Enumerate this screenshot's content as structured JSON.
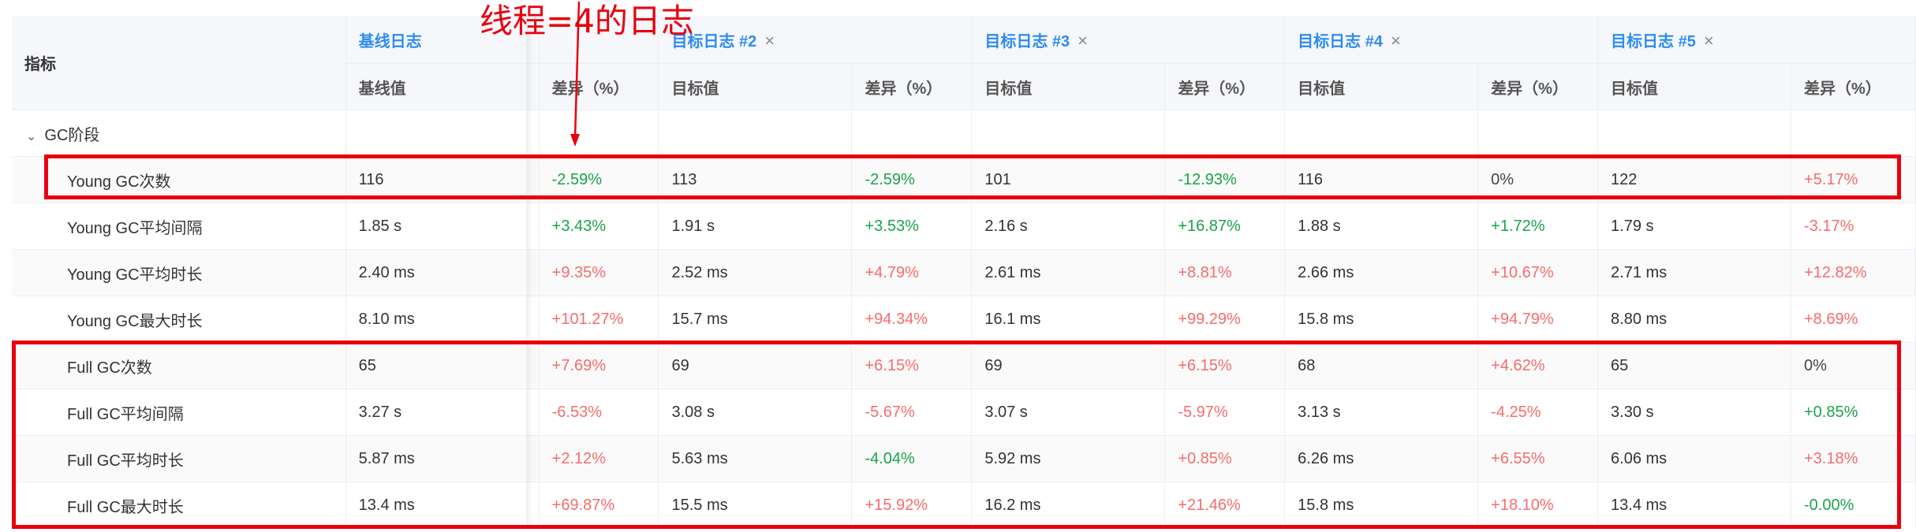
{
  "header": {
    "metric_label": "指标",
    "baseline_title": "基线日志",
    "baseline_value_label": "基线值",
    "diff_label": "差异（%）",
    "target_value_label": "目标值",
    "close_glyph": "×",
    "targets": [
      {
        "title": "目标日志 #2"
      },
      {
        "title": "目标日志 #3"
      },
      {
        "title": "目标日志 #4"
      },
      {
        "title": "目标日志 #5"
      }
    ]
  },
  "group": {
    "label": "GC阶段",
    "chevron": "⌄"
  },
  "rows": [
    {
      "name": "Young GC次数",
      "base": "116",
      "cells": [
        {
          "diff": "-2.59%",
          "t": "negative"
        },
        {
          "value": "113"
        },
        {
          "diff": "-2.59%",
          "t": "negative"
        },
        {
          "value": "101"
        },
        {
          "diff": "-12.93%",
          "t": "negative"
        },
        {
          "value": "116"
        },
        {
          "diff": "0%",
          "t": "zero"
        },
        {
          "value": "122"
        },
        {
          "diff": "+5.17%",
          "t": "positive"
        }
      ]
    },
    {
      "name": "Young GC平均间隔",
      "base": "1.85 s",
      "cells": [
        {
          "diff": "+3.43%",
          "t": "negative"
        },
        {
          "value": "1.91 s"
        },
        {
          "diff": "+3.53%",
          "t": "negative"
        },
        {
          "value": "2.16 s"
        },
        {
          "diff": "+16.87%",
          "t": "negative"
        },
        {
          "value": "1.88 s"
        },
        {
          "diff": "+1.72%",
          "t": "negative"
        },
        {
          "value": "1.79 s"
        },
        {
          "diff": "-3.17%",
          "t": "positive"
        }
      ]
    },
    {
      "name": "Young GC平均时长",
      "base": "2.40 ms",
      "cells": [
        {
          "diff": "+9.35%",
          "t": "positive"
        },
        {
          "value": "2.52 ms"
        },
        {
          "diff": "+4.79%",
          "t": "positive"
        },
        {
          "value": "2.61 ms"
        },
        {
          "diff": "+8.81%",
          "t": "positive"
        },
        {
          "value": "2.66 ms"
        },
        {
          "diff": "+10.67%",
          "t": "positive"
        },
        {
          "value": "2.71 ms"
        },
        {
          "diff": "+12.82%",
          "t": "positive"
        }
      ]
    },
    {
      "name": "Young GC最大时长",
      "base": "8.10 ms",
      "cells": [
        {
          "diff": "+101.27%",
          "t": "positive"
        },
        {
          "value": "15.7 ms"
        },
        {
          "diff": "+94.34%",
          "t": "positive"
        },
        {
          "value": "16.1 ms"
        },
        {
          "diff": "+99.29%",
          "t": "positive"
        },
        {
          "value": "15.8 ms"
        },
        {
          "diff": "+94.79%",
          "t": "positive"
        },
        {
          "value": "8.80 ms"
        },
        {
          "diff": "+8.69%",
          "t": "positive"
        }
      ]
    },
    {
      "name": "Full GC次数",
      "base": "65",
      "cells": [
        {
          "diff": "+7.69%",
          "t": "positive"
        },
        {
          "value": "69"
        },
        {
          "diff": "+6.15%",
          "t": "positive"
        },
        {
          "value": "69"
        },
        {
          "diff": "+6.15%",
          "t": "positive"
        },
        {
          "value": "68"
        },
        {
          "diff": "+4.62%",
          "t": "positive"
        },
        {
          "value": "65"
        },
        {
          "diff": "0%",
          "t": "zero"
        }
      ]
    },
    {
      "name": "Full GC平均间隔",
      "base": "3.27 s",
      "cells": [
        {
          "diff": "-6.53%",
          "t": "positive"
        },
        {
          "value": "3.08 s"
        },
        {
          "diff": "-5.67%",
          "t": "positive"
        },
        {
          "value": "3.07 s"
        },
        {
          "diff": "-5.97%",
          "t": "positive"
        },
        {
          "value": "3.13 s"
        },
        {
          "diff": "-4.25%",
          "t": "positive"
        },
        {
          "value": "3.30 s"
        },
        {
          "diff": "+0.85%",
          "t": "negative"
        }
      ]
    },
    {
      "name": "Full GC平均时长",
      "base": "5.87 ms",
      "cells": [
        {
          "diff": "+2.12%",
          "t": "positive"
        },
        {
          "value": "5.63 ms"
        },
        {
          "diff": "-4.04%",
          "t": "negative"
        },
        {
          "value": "5.92 ms"
        },
        {
          "diff": "+0.85%",
          "t": "positive"
        },
        {
          "value": "6.26 ms"
        },
        {
          "diff": "+6.55%",
          "t": "positive"
        },
        {
          "value": "6.06 ms"
        },
        {
          "diff": "+3.18%",
          "t": "positive"
        }
      ]
    },
    {
      "name": "Full GC最大时长",
      "base": "13.4 ms",
      "cells": [
        {
          "diff": "+69.87%",
          "t": "positive"
        },
        {
          "value": "15.5 ms"
        },
        {
          "diff": "+15.92%",
          "t": "positive"
        },
        {
          "value": "16.2 ms"
        },
        {
          "diff": "+21.46%",
          "t": "positive"
        },
        {
          "value": "15.8 ms"
        },
        {
          "diff": "+18.10%",
          "t": "positive"
        },
        {
          "value": "13.4 ms"
        },
        {
          "diff": "-0.00%",
          "t": "negative"
        }
      ]
    }
  ],
  "annotation": {
    "text": "线程=4的日志",
    "color": "#e8000f"
  },
  "colors": {
    "link": "#2d8cf0",
    "positive": "#f56c6c",
    "negative": "#1aa34a",
    "highlight": "#e8000f"
  }
}
